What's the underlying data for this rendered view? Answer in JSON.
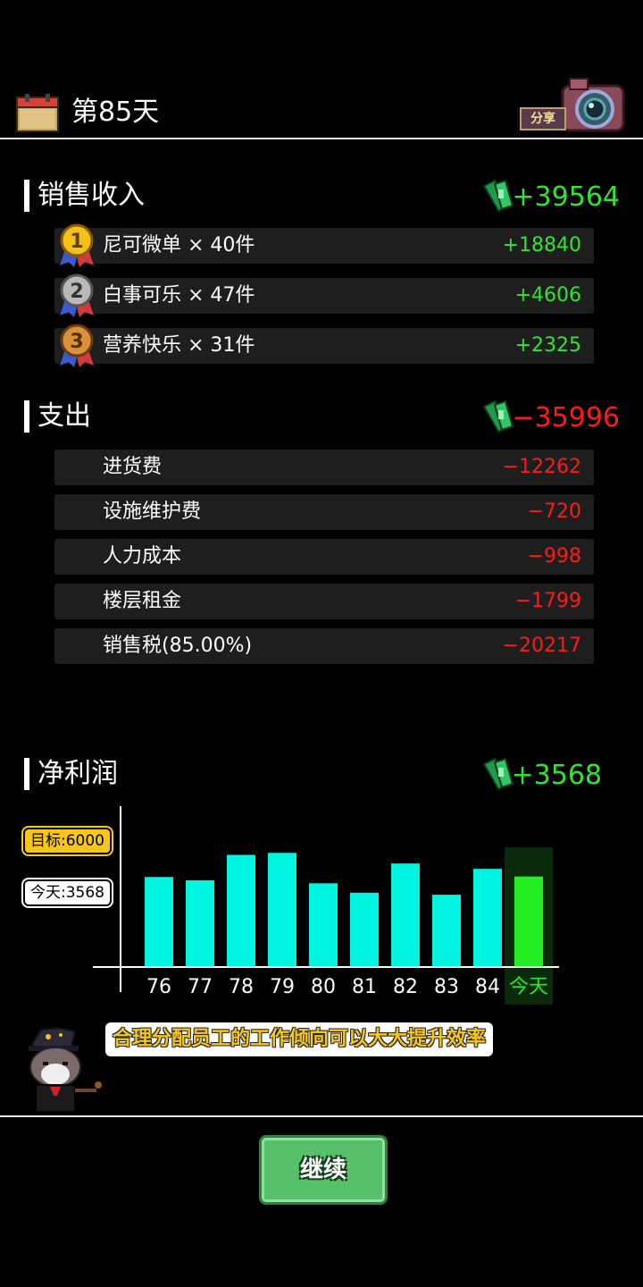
{
  "header": {
    "day_title": "第85天",
    "share_label": "分享"
  },
  "sales": {
    "title": "销售收入",
    "total": "+39564",
    "items": [
      {
        "rank": "1",
        "label": "尼可微单 × 40件",
        "value": "+18840"
      },
      {
        "rank": "2",
        "label": "白事可乐 × 47件",
        "value": "+4606"
      },
      {
        "rank": "3",
        "label": "营养快乐 × 31件",
        "value": "+2325"
      }
    ]
  },
  "expenses": {
    "title": "支出",
    "total": "−35996",
    "items": [
      {
        "label": "进货费",
        "value": "−12262"
      },
      {
        "label": "设施维护费",
        "value": "−720"
      },
      {
        "label": "人力成本",
        "value": "−998"
      },
      {
        "label": "楼层租金",
        "value": "−1799"
      },
      {
        "label": "销售税(85.00%)",
        "value": "−20217"
      }
    ]
  },
  "profit": {
    "title": "净利润",
    "total": "+3568",
    "goal_tag": "目标:6000",
    "today_tag": "今天:3568"
  },
  "chart_data": {
    "type": "bar",
    "categories": [
      "76",
      "77",
      "78",
      "79",
      "80",
      "81",
      "82",
      "83",
      "84",
      "今天"
    ],
    "values": [
      3550,
      3420,
      4420,
      4500,
      3300,
      2930,
      4080,
      2850,
      3870,
      3568
    ],
    "highlight_category": "今天",
    "ylim": [
      0,
      6200
    ],
    "bar_color": "#00f5e0",
    "highlight_color": "#22ee22",
    "highlight_bg": "#0b2a0b"
  },
  "tip": {
    "text": "合理分配员工的工作倾向可以大大提升效率"
  },
  "continue_label": "继续",
  "colors": {
    "positive": "#2ee62e",
    "negative": "#ff1a1a",
    "background": "#000000"
  }
}
